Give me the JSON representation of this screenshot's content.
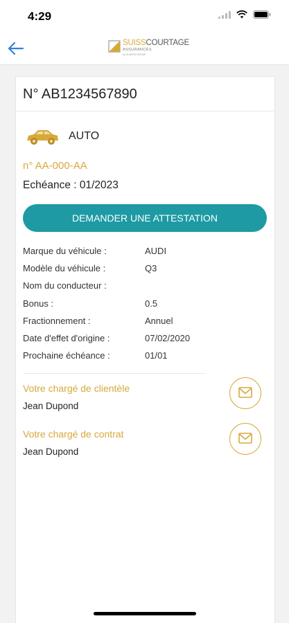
{
  "status_bar": {
    "time": "4:29"
  },
  "nav": {
    "logo_brand_first": "SUISS",
    "logo_brand_second": "COURTAGE",
    "logo_sub": "ASSURANCES",
    "logo_sub2": "by HUSSON GROUP"
  },
  "contract": {
    "number": "N° AB1234567890",
    "product": "AUTO",
    "plate": "n° AA-000-AA",
    "echeance": "Echéance : 01/2023",
    "attestation_button": "DEMANDER UNE ATTESTATION",
    "details": [
      {
        "label": "Marque du véhicule :",
        "value": "AUDI"
      },
      {
        "label": "Modèle du véhicule :",
        "value": "Q3"
      },
      {
        "label": "Nom du conducteur :",
        "value": ""
      },
      {
        "label": "Bonus :",
        "value": "0.5"
      },
      {
        "label": "Fractionnement :",
        "value": "Annuel"
      },
      {
        "label": "Date d'effet d'origine :",
        "value": "07/02/2020"
      },
      {
        "label": "Prochaine échéance :",
        "value": "01/01"
      }
    ]
  },
  "contacts": [
    {
      "role": "Votre chargé de clientèle",
      "name": "Jean Dupond"
    },
    {
      "role": "Votre chargé de contrat",
      "name": "Jean Dupond"
    }
  ],
  "colors": {
    "accent_gold": "#d7a93a",
    "button_teal": "#1d9aa3",
    "back_blue": "#2f7fe0"
  },
  "icons": {
    "back": "arrow-left-icon",
    "product": "car-icon",
    "mail": "envelope-icon"
  }
}
